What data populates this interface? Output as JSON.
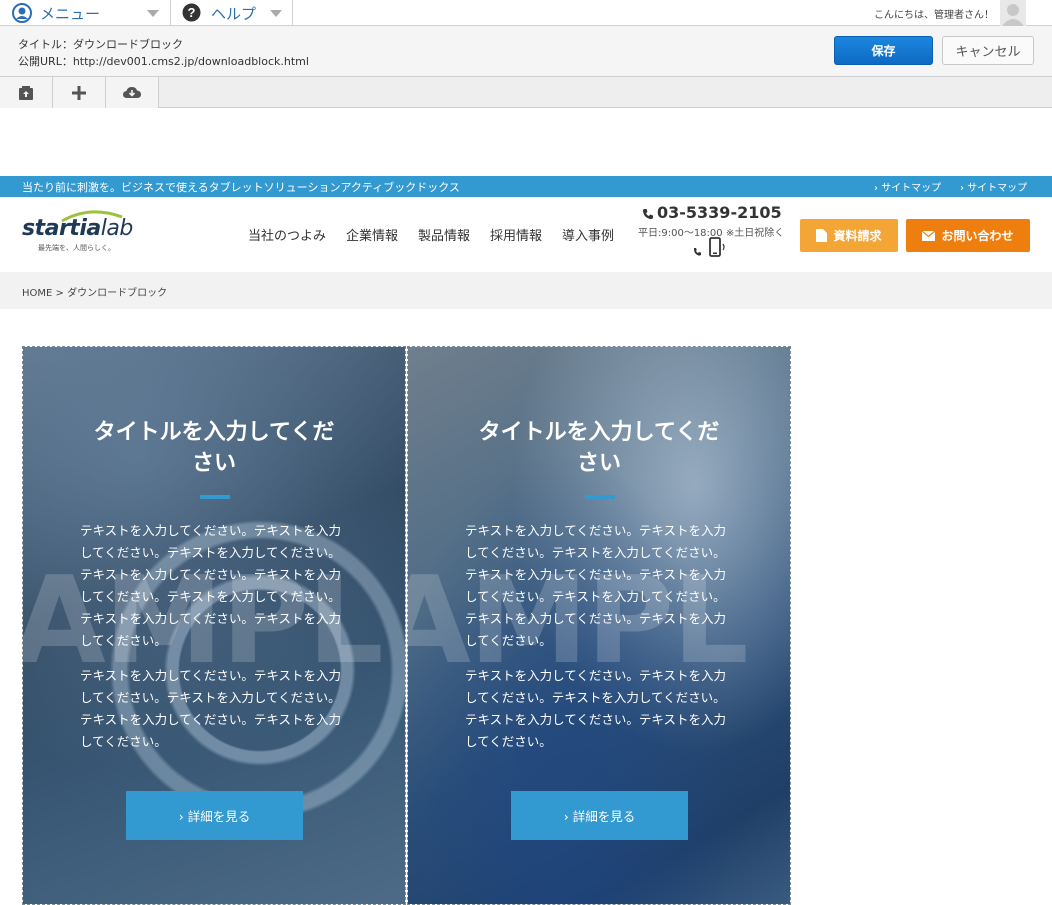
{
  "cms": {
    "menu_label": "メニュー",
    "help_label": "ヘルプ",
    "greeting": "こんにちは、管理者さん！",
    "title_line": "タイトル：ダウンロードブロック",
    "url_line": "公開URL：http://dev001.cms2.jp/downloadblock.html",
    "save_label": "保存",
    "cancel_label": "キャンセル",
    "colors": {
      "save": "#0e6ac4",
      "link": "#2a6fb3"
    }
  },
  "site": {
    "tagline": "当たり前に刺激を。ビジネスで使えるタブレットソリューションアクティブックドックス",
    "sitemap_links": [
      "サイトマップ",
      "サイトマップ"
    ],
    "logo": {
      "word": "startia",
      "word2": "lab",
      "tag": "最先端を、人間らしく。"
    },
    "nav": [
      "当社のつよみ",
      "企業情報",
      "製品情報",
      "採用情報",
      "導入事例"
    ],
    "phone": "03-5339-2105",
    "hours": "平日:9:00〜18:00 ※土日祝除く",
    "doc_request": "資料請求",
    "contact": "お問い合わせ",
    "breadcrumb": "HOME > ダウンロードブロック",
    "accent": "#3399d1"
  },
  "cards": [
    {
      "title": "タイトルを入力してください",
      "para1": "テキストを入力してください。テキストを入力してください。テキストを入力してください。テキストを入力してください。テキストを入力してください。テキストを入力してください。テキストを入力してください。テキストを入力してください。",
      "para2": "テキストを入力してください。テキストを入力してください。テキストを入力してください。テキストを入力してください。テキストを入力してください。",
      "watermark": "AMPL",
      "button": "› 詳細を見る"
    },
    {
      "title": "タイトルを入力してください",
      "para1": "テキストを入力してください。テキストを入力してください。テキストを入力してください。テキストを入力してください。テキストを入力してください。テキストを入力してください。テキストを入力してください。テキストを入力してください。",
      "para2": "テキストを入力してください。テキストを入力してください。テキストを入力してください。テキストを入力してください。テキストを入力してください。",
      "watermark": "AMPL",
      "button": "› 詳細を見る"
    }
  ]
}
